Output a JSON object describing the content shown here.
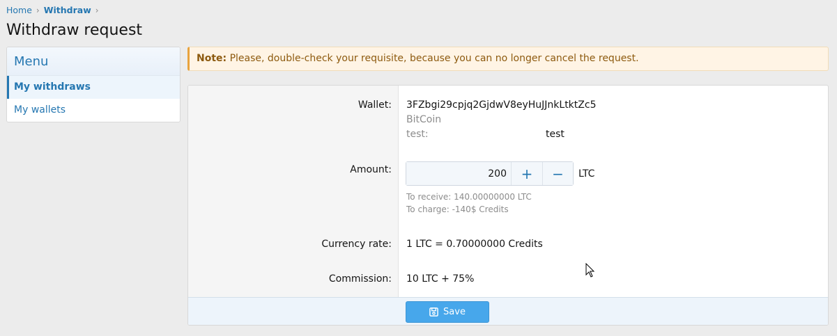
{
  "breadcrumb": {
    "home": "Home",
    "current": "Withdraw",
    "sep": "›"
  },
  "page": {
    "title": "Withdraw request"
  },
  "sidebar": {
    "title": "Menu",
    "items": [
      {
        "label": "My withdraws",
        "active": true
      },
      {
        "label": "My wallets",
        "active": false
      }
    ]
  },
  "note": {
    "prefix": "Note:",
    "text": "Please, double-check your requisite, because you can no longer cancel the request."
  },
  "form": {
    "wallet": {
      "label": "Wallet:",
      "address": "3FZbgi29cpjq2GjdwV8eyHuJJnkLtktZc5",
      "currency": "BitCoin",
      "field_label": "test:",
      "field_value": "test"
    },
    "amount": {
      "label": "Amount:",
      "value": "200",
      "unit": "LTC",
      "plus": "+",
      "minus": "−",
      "receive": "To receive: 140.00000000 LTC",
      "charge": "To charge: -140$ Credits"
    },
    "rate": {
      "label": "Currency rate:",
      "value": "1 LTC = 0.70000000 Credits"
    },
    "commission": {
      "label": "Commission:",
      "value": "10 LTC + 75%"
    },
    "save_label": "Save"
  },
  "colors": {
    "accent": "#2577b1",
    "button": "#47a7eb",
    "note_bg": "#fff4e5",
    "note_border": "#e8a33d"
  }
}
